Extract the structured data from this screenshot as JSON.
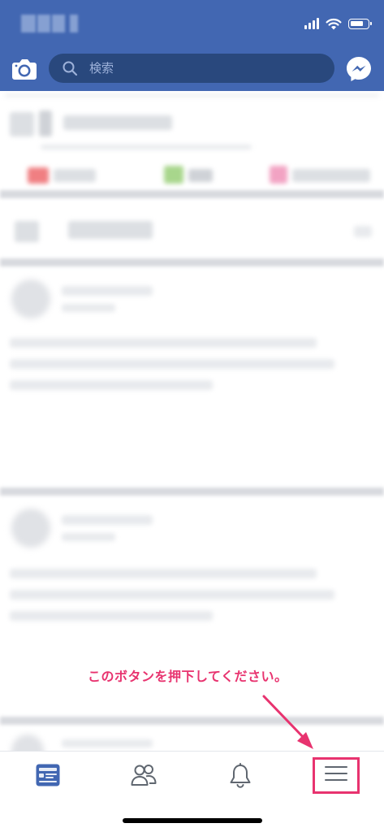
{
  "header": {
    "background_color": "#4267b2",
    "search": {
      "placeholder": "検索"
    },
    "icons": {
      "left": "camera-icon",
      "right": "messenger-icon"
    }
  },
  "status_bar": {
    "carrier_blurred": true,
    "icons": [
      "signal-icon",
      "wifi-icon",
      "battery-icon"
    ]
  },
  "annotation": {
    "text": "このボタンを押下してください。",
    "color": "#e8336f"
  },
  "tabbar": {
    "tabs": [
      {
        "name": "news-feed",
        "icon": "news-feed-icon",
        "active": true
      },
      {
        "name": "friends",
        "icon": "friends-icon",
        "active": false
      },
      {
        "name": "notifications",
        "icon": "bell-icon",
        "active": false
      },
      {
        "name": "menu",
        "icon": "hamburger-menu-icon",
        "active": false,
        "highlighted": true
      }
    ],
    "active_color": "#4267b2",
    "inactive_color": "#606770"
  }
}
